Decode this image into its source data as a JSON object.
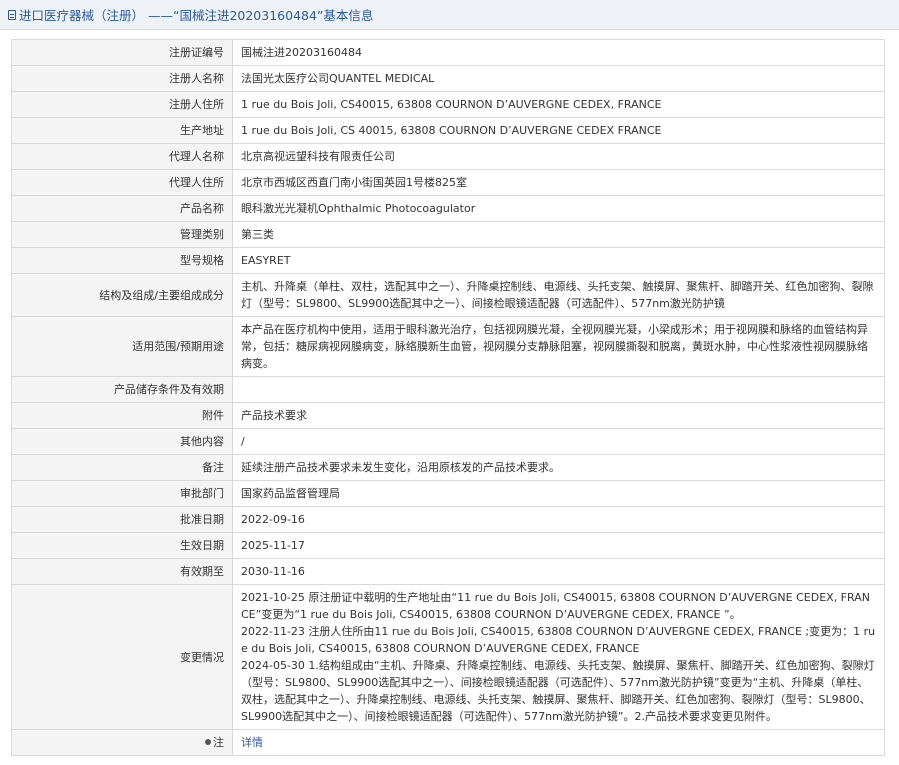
{
  "header": {
    "title": "进口医疗器械（注册） ——“国械注进20203160484”基本信息"
  },
  "fields": [
    {
      "label": "注册证编号",
      "value": "国械注进20203160484"
    },
    {
      "label": "注册人名称",
      "value": "法国光太医疗公司QUANTEL MEDICAL"
    },
    {
      "label": "注册人住所",
      "value": "1 rue du Bois Joli, CS40015, 63808 COURNON D’AUVERGNE CEDEX, FRANCE"
    },
    {
      "label": "生产地址",
      "value": "1 rue du Bois Joli, CS 40015, 63808 COURNON D’AUVERGNE CEDEX FRANCE"
    },
    {
      "label": "代理人名称",
      "value": "北京高视远望科技有限责任公司"
    },
    {
      "label": "代理人住所",
      "value": "北京市西城区西直门南小街国英园1号楼825室"
    },
    {
      "label": "产品名称",
      "value": "眼科激光光凝机Ophthalmic Photocoagulator"
    },
    {
      "label": "管理类别",
      "value": "第三类"
    },
    {
      "label": "型号规格",
      "value": "EASYRET"
    },
    {
      "label": "结构及组成/主要组成成分",
      "value": "主机、升降桌（单柱、双柱，选配其中之一）、升降桌控制线、电源线、头托支架、触摸屏、聚焦杆、脚踏开关、红色加密狗、裂隙灯（型号：SL9800、SL9900选配其中之一）、间接检眼镜适配器（可选配件）、577nm激光防护镜"
    },
    {
      "label": "适用范围/预期用途",
      "value": "本产品在医疗机构中使用，适用于眼科激光治疗，包括视网膜光凝，全视网膜光凝，小梁成形术；用于视网膜和脉络的血管结构异常，包括：糖尿病视网膜病变，脉络膜新生血管，视网膜分支静脉阻塞，视网膜撕裂和脱离，黄斑水肿，中心性浆液性视网膜脉络病变。"
    },
    {
      "label": "产品储存条件及有效期",
      "value": ""
    },
    {
      "label": "附件",
      "value": "产品技术要求"
    },
    {
      "label": "其他内容",
      "value": "/"
    },
    {
      "label": "备注",
      "value": "延续注册产品技术要求未发生变化，沿用原核发的产品技术要求。"
    },
    {
      "label": "审批部门",
      "value": "国家药品监督管理局"
    },
    {
      "label": "批准日期",
      "value": "2022-09-16"
    },
    {
      "label": "生效日期",
      "value": "2025-11-17"
    },
    {
      "label": "有效期至",
      "value": "2030-11-16"
    }
  ],
  "changes": {
    "label": "变更情况",
    "entries": [
      "2021-10-25 原注册证中载明的生产地址由“11 rue du Bois Joli, CS40015, 63808 COURNON D’AUVERGNE CEDEX, FRANCE”变更为“1 rue du Bois Joli, CS40015, 63808 COURNON D’AUVERGNE CEDEX, FRANCE ”。",
      "2022-11-23 注册人住所由11 rue du Bois Joli, CS40015, 63808 COURNON D’AUVERGNE CEDEX, FRANCE ;变更为：1 rue du Bois Joli, CS40015, 63808 COURNON D’AUVERGNE CEDEX, FRANCE",
      "2024-05-30 1.结构组成由“主机、升降桌、升降桌控制线、电源线、头托支架、触摸屏、聚焦杆、脚踏开关、红色加密狗、裂隙灯（型号：SL9800、SL9900选配其中之一）、间接检眼镜适配器（可选配件）、577nm激光防护镜”变更为“主机、升降桌（单柱、双柱，选配其中之一）、升降桌控制线、电源线、头托支架、触摸屏、聚焦杆、脚踏开关、红色加密狗、裂隙灯（型号：SL9800、SL9900选配其中之一）、间接检眼镜适配器（可选配件）、577nm激光防护镜”。2.产品技术要求变更见附件。"
    ]
  },
  "note": {
    "label": "注",
    "link_text": "详情"
  },
  "colors": {
    "accent": "#2a5aa5",
    "label_bg": "#f4f4f4",
    "border": "#d9d9d9"
  }
}
